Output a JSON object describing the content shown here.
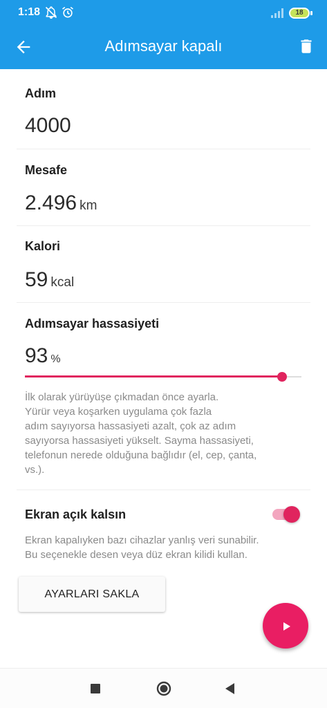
{
  "status_bar": {
    "time": "1:18",
    "battery": "18",
    "icons": [
      "notifications-off-icon",
      "alarm-icon",
      "signal-icon",
      "battery-icon"
    ]
  },
  "app_bar": {
    "title": "Adımsayar kapalı",
    "icons": [
      "back-arrow-icon",
      "delete-icon"
    ]
  },
  "steps": {
    "label": "Adım",
    "value": "4000"
  },
  "distance": {
    "label": "Mesafe",
    "value": "2.496",
    "unit": "km"
  },
  "calories": {
    "label": "Kalori",
    "value": "59",
    "unit": "kcal"
  },
  "sensitivity": {
    "label": "Adımsayar hassasiyeti",
    "value": "93",
    "unit": "%",
    "slider_fraction": 0.93,
    "help_lines": [
      "İlk olarak yürüyüşe çıkmadan önce ayarla.",
      "Yürür veya koşarken uygulama çok fazla",
      "adım sayıyorsa hassasiyeti azalt, çok az adım",
      "sayıyorsa hassasiyeti yükselt. Sayma hassasiyeti,",
      "telefonun nerede olduğuna bağlıdır (el, cep, çanta,",
      "vs.)."
    ]
  },
  "keep_screen_on": {
    "label": "Ekran açık kalsın",
    "enabled": true,
    "help_lines": [
      "Ekran kapalıyken bazı cihazlar yanlış veri sunabilir.",
      "Bu seçenekle desen veya düz ekran kilidi kullan."
    ]
  },
  "save_button": {
    "label": "AYARLARI SAKLA"
  },
  "fab": {
    "icon": "play-icon"
  },
  "nav_bar": {
    "icons": [
      "recents-square-icon",
      "home-circle-icon",
      "back-triangle-icon"
    ]
  },
  "colors": {
    "primary": "#1e9be8",
    "accent": "#e0245e",
    "fab": "#e91e63",
    "text": "#212121",
    "helper_text": "#8a8a8a"
  }
}
